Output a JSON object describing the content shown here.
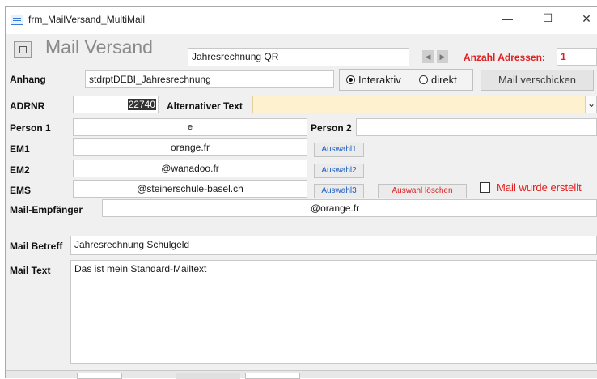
{
  "window": {
    "title": "frm_MailVersand_MultiMail",
    "minimize": "—",
    "maximize": "☐",
    "close": "✕"
  },
  "header": {
    "form_title": "Mail Versand",
    "report_name": "Jahresrechnung QR",
    "count_label": "Anzahl Adressen:",
    "count_value": "1"
  },
  "anhang": {
    "label": "Anhang",
    "value": "stdrptDEBI_Jahresrechnung",
    "radio_interactive": "Interaktiv",
    "radio_direct": "direkt",
    "send_button": "Mail verschicken"
  },
  "adrnr": {
    "label": "ADRNR",
    "value": "22740",
    "alt_text_label": "Alternativer Text",
    "alt_text_value": ""
  },
  "person": {
    "person1_label": "Person 1",
    "person1_value": "e",
    "person2_label": "Person 2",
    "person2_value": ""
  },
  "emails": {
    "em1_label": "EM1",
    "em1_value": "orange.fr",
    "em1_button": "Auswahl1",
    "em2_label": "EM2",
    "em2_value": "@wanadoo.fr",
    "em2_button": "Auswahl2",
    "ems_label": "EMS",
    "ems_value": "@steinerschule-basel.ch",
    "ems_button": "Auswahl3",
    "clear_button": "Auswahl löschen",
    "created_label": "Mail wurde erstellt"
  },
  "recipient": {
    "label": "Mail-Empfänger",
    "value": "@orange.fr"
  },
  "mail": {
    "subject_label": "Mail Betreff",
    "subject_value": "Jahresrechnung Schulgeld",
    "text_label": "Mail Text",
    "text_value": "Das ist mein Standard-Mailtext"
  },
  "icons": {
    "app_icon": "form-icon",
    "form_icon": "form-icon",
    "prev": "◀",
    "next": "▶",
    "dropdown": "⌄"
  },
  "colors": {
    "accent_red": "#e02020",
    "link_blue": "#1d5fbf",
    "alt_text_bg": "#fdf1d0",
    "adrnr_highlight": "#333333"
  }
}
